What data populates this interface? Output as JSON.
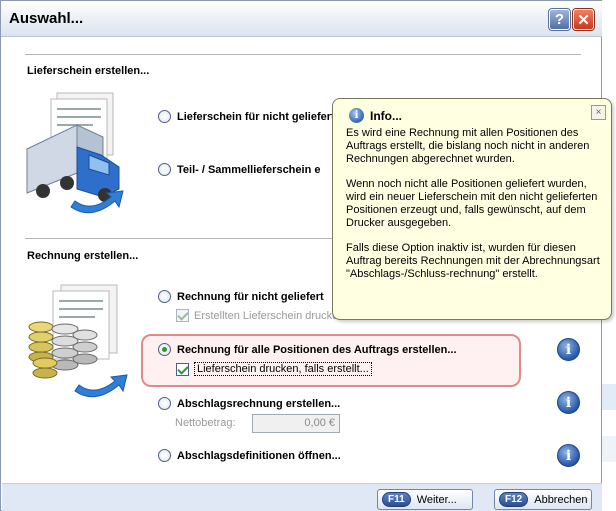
{
  "window": {
    "title": "Auswahl...",
    "help_glyph": "?",
    "close_glyph": "✕"
  },
  "lieferschein": {
    "section_title": "Lieferschein erstellen...",
    "option1": "Lieferschein für nicht geliefert",
    "option2": "Teil- / Sammellieferschein e"
  },
  "rechnung": {
    "section_title": "Rechnung erstellen...",
    "option_nicht_geliefert": "Rechnung für nicht geliefert",
    "sub_erstellten_lieferschein": "Erstellten Lieferschein drucke",
    "option_alle_positionen": "Rechnung für alle Positionen des Auftrags erstellen...",
    "sub_lieferschein_drucken": "Lieferschein drucken, falls erstellt...",
    "option_abschlag": "Abschlagsrechnung erstellen...",
    "netto_label": "Nettobetrag:",
    "netto_value": "0,00 €",
    "option_abschlagsdef": "Abschlagsdefinitionen öffnen..."
  },
  "info_glyph": "i",
  "tooltip": {
    "title": "Info...",
    "close_glyph": "×",
    "p1": "Es wird eine Rechnung mit allen Positionen des Auftrags erstellt, die bislang noch nicht in anderen Rechnungen abgerechnet wurden.",
    "p2": "Wenn noch nicht alle Positionen geliefert wurden, wird ein neuer Lieferschein mit den nicht gelieferten Positionen erzeugt und, falls gewünscht, auf dem Drucker ausgegeben.",
    "p3": "Falls diese Option inaktiv ist, wurden für diesen Auftrag bereits Rechnungen mit der Abrechnungsart \"Abschlags-/Schluss-rechnung\" erstellt."
  },
  "footer": {
    "weiter_key": "F11",
    "weiter_label": "Weiter...",
    "abbrechen_key": "F12",
    "abbrechen_label": "Abbrechen"
  },
  "icons": {
    "truck": "truck-document-icon",
    "coins": "coins-document-icon",
    "info": "info-icon"
  },
  "colors": {
    "accent": "#2757a7",
    "highlight_border": "#e08a8a",
    "tooltip_bg": "#ffffe1"
  }
}
